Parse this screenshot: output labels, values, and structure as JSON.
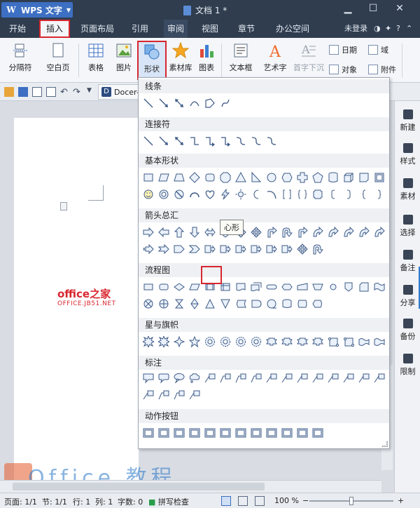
{
  "titlebar": {
    "app_name": "WPS 文字",
    "logo_glyph": "W",
    "doc_title": "文档 1 *"
  },
  "menubar": {
    "items": [
      "开始",
      "插入",
      "页面布局",
      "引用",
      "审阅",
      "视图",
      "章节",
      "办公空间"
    ],
    "active": "插入",
    "login": "未登录"
  },
  "ribbon": {
    "fenge": "分隔符",
    "kongbai": "空白页",
    "biaoge": "表格",
    "tupian": "图片",
    "xingzhuang": "形状",
    "sucaiku": "素材库",
    "tubiao": "图表",
    "wenbenkuang": "文本框",
    "yishuzi": "艺术字",
    "shouzixiachen": "首字下沉",
    "riqi": "日期",
    "yu": "域",
    "duixiang": "对象",
    "fujian": "附件"
  },
  "quickbar": {
    "doc_tab": "Docer-"
  },
  "document": {
    "watermark_cn": "office之家",
    "watermark_en": "OFFICE.JB51.NET",
    "watermark_big": "Office 教程"
  },
  "shapes_panel": {
    "cat_lines": "线条",
    "cat_connectors": "连接符",
    "cat_basic": "基本形状",
    "cat_arrows": "箭头总汇",
    "cat_flowchart": "流程图",
    "cat_stars": "星与旗帜",
    "cat_callouts": "标注",
    "cat_actions": "动作按钮",
    "tooltip": "心形"
  },
  "sidepanel": {
    "items": [
      "新建",
      "样式",
      "素材",
      "选择",
      "备注",
      "分享",
      "备份",
      "限制"
    ]
  },
  "statusbar": {
    "page": "页面: 1/1",
    "section": "节: 1/1",
    "row": "行: 1",
    "col": "列: 1",
    "words": "字数: 0",
    "spell": "拼写检查",
    "zoom": "100 %",
    "zoom_level": 0.5
  },
  "colors": {
    "accent_red": "#d8262f",
    "title_bg": "#2f3d4f",
    "app_btn": "#3d6fc2"
  }
}
